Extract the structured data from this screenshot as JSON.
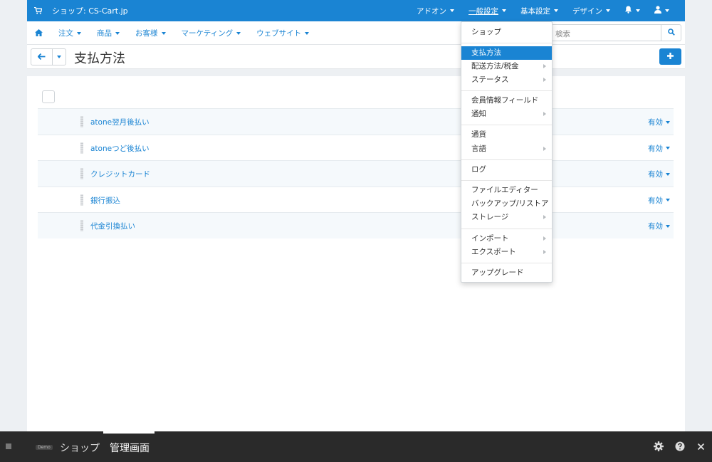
{
  "topbar": {
    "shop_title": "ショップ: CS-Cart.jp",
    "menu": [
      "アドオン",
      "一般設定",
      "基本設定",
      "デザイン"
    ]
  },
  "nav": {
    "items": [
      "注文",
      "商品",
      "お客様",
      "マーケティング",
      "ウェブサイト"
    ],
    "search_placeholder": "検索"
  },
  "page": {
    "title": "支払方法"
  },
  "payments": [
    {
      "name": "atone翌月後払い",
      "status": "有効"
    },
    {
      "name": "atoneつど後払い",
      "status": "有効"
    },
    {
      "name": "クレジットカード",
      "status": "有効"
    },
    {
      "name": "銀行振込",
      "status": "有効"
    },
    {
      "name": "代金引換払い",
      "status": "有効"
    }
  ],
  "dropdown": {
    "items": [
      "ショップ",
      "支払方法",
      "配送方法/税金",
      "ステータス",
      "会員情報フィールド",
      "通知",
      "通貨",
      "言語",
      "ログ",
      "ファイルエディター",
      "バックアップ/リストア",
      "ストレージ",
      "インポート",
      "エクスポート",
      "アップグレード"
    ]
  },
  "bottom": {
    "demo_badge": "Demo",
    "tabs": [
      "ショップ",
      "管理画面"
    ]
  },
  "colors": {
    "accent": "#1a84d3",
    "bottom_bar": "#2a2a2a"
  }
}
